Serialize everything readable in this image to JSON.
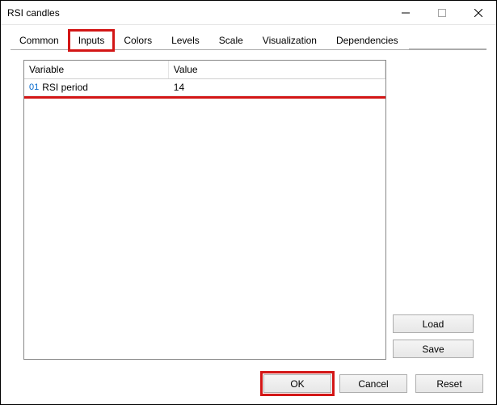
{
  "window": {
    "title": "RSI candles"
  },
  "tabs": {
    "items": [
      {
        "label": "Common"
      },
      {
        "label": "Inputs"
      },
      {
        "label": "Colors"
      },
      {
        "label": "Levels"
      },
      {
        "label": "Scale"
      },
      {
        "label": "Visualization"
      },
      {
        "label": "Dependencies"
      }
    ],
    "active_index": 1
  },
  "table": {
    "headers": {
      "variable": "Variable",
      "value": "Value"
    },
    "rows": [
      {
        "index": "01",
        "variable": "RSI period",
        "value": "14"
      }
    ]
  },
  "side": {
    "load": "Load",
    "save": "Save"
  },
  "footer": {
    "ok": "OK",
    "cancel": "Cancel",
    "reset": "Reset"
  }
}
